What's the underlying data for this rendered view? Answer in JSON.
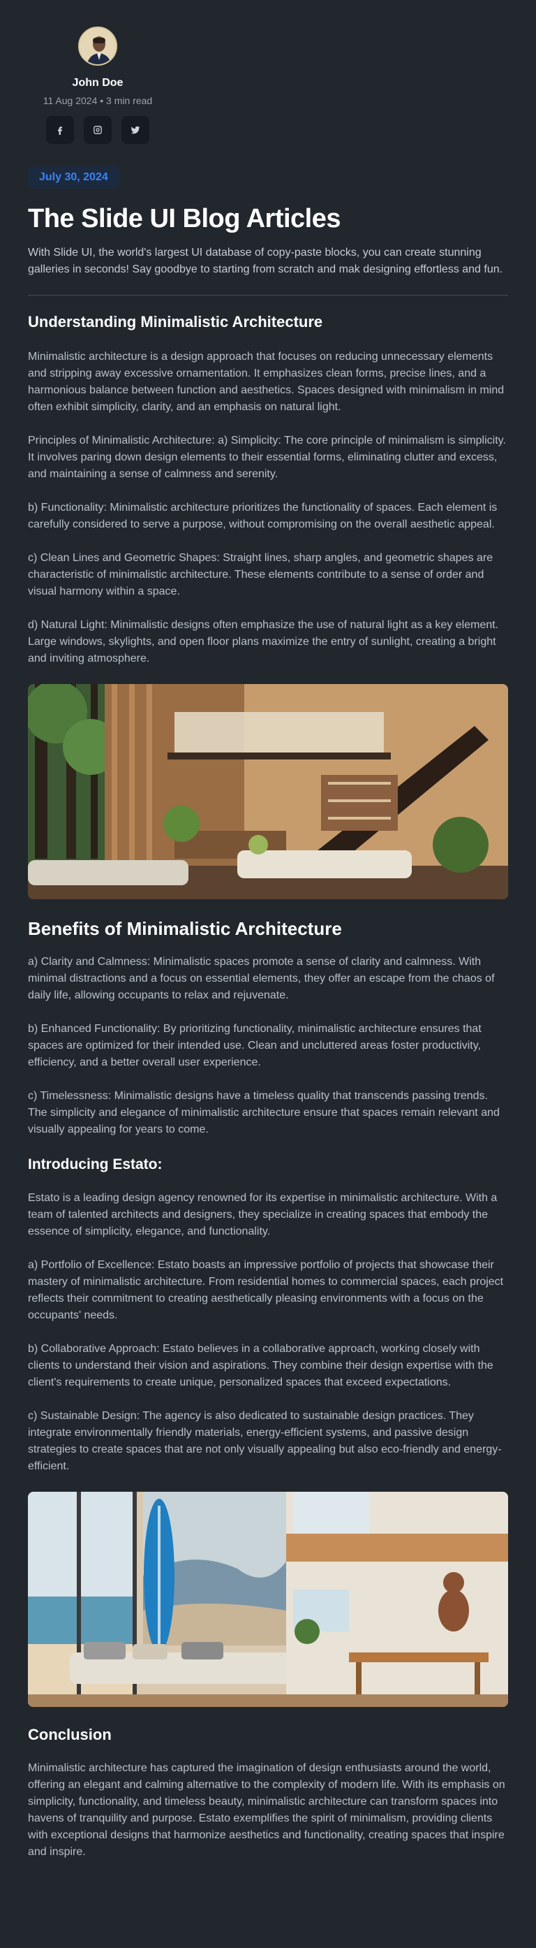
{
  "author": {
    "name": "John Doe",
    "meta": "11 Aug 2024 • 3 min read",
    "socials": [
      {
        "icon": "facebook-icon"
      },
      {
        "icon": "instagram-icon"
      },
      {
        "icon": "twitter-icon"
      }
    ]
  },
  "article": {
    "date": "July 30, 2024",
    "title": "The Slide UI Blog Articles",
    "intro": "With Slide UI, the world's largest UI database of copy-paste blocks, you can create stunning galleries in seconds! Say goodbye to starting from scratch and mak designing effortless and fun.",
    "section1": {
      "heading": "Understanding Minimalistic Architecture",
      "paragraphs": [
        "Minimalistic architecture is a design approach that focuses on reducing unnecessary elements and stripping away excessive ornamentation. It emphasizes clean forms, precise lines, and a harmonious balance between function and aesthetics. Spaces designed with minimalism in mind often exhibit simplicity, clarity, and an emphasis on natural light.",
        "Principles of Minimalistic Architecture: a) Simplicity: The core principle of minimalism is simplicity. It involves paring down design elements to their essential forms, eliminating clutter and excess, and maintaining a sense of calmness and serenity.",
        "b) Functionality: Minimalistic architecture prioritizes the functionality of spaces. Each element is carefully considered to serve a purpose, without compromising on the overall aesthetic appeal.",
        "c) Clean Lines and Geometric Shapes: Straight lines, sharp angles, and geometric shapes are characteristic of minimalistic architecture. These elements contribute to a sense of order and visual harmony within a space.",
        "d) Natural Light: Minimalistic designs often emphasize the use of natural light as a key element. Large windows, skylights, and open floor plans maximize the entry of sunlight, creating a bright and inviting atmosphere."
      ]
    },
    "section2": {
      "heading": "Benefits of Minimalistic Architecture",
      "paragraphs": [
        "a) Clarity and Calmness: Minimalistic spaces promote a sense of clarity and calmness. With minimal distractions and a focus on essential elements, they offer an escape from the chaos of daily life, allowing occupants to relax and rejuvenate.",
        "b) Enhanced Functionality: By prioritizing functionality, minimalistic architecture ensures that spaces are optimized for their intended use. Clean and uncluttered areas foster productivity, efficiency, and a better overall user experience.",
        "c) Timelessness: Minimalistic designs have a timeless quality that transcends passing trends. The simplicity and elegance of minimalistic architecture ensure that spaces remain relevant and visually appealing for years to come."
      ]
    },
    "section3": {
      "heading": "Introducing Estato:",
      "paragraphs": [
        "Estato is a leading design agency renowned for its expertise in minimalistic architecture. With a team of talented architects and designers, they specialize in creating spaces that embody the essence of simplicity, elegance, and functionality.",
        "a) Portfolio of Excellence: Estato boasts an impressive portfolio of projects that showcase their mastery of minimalistic architecture. From residential homes to commercial spaces, each project reflects their commitment to creating aesthetically pleasing environments with a focus on the occupants' needs.",
        "b) Collaborative Approach: Estato believes in a collaborative approach, working closely with clients to understand their vision and aspirations. They combine their design expertise with the client's requirements to create unique, personalized spaces that exceed expectations.",
        "c) Sustainable Design: The agency is also dedicated to sustainable design practices. They integrate environmentally friendly materials, energy-efficient systems, and passive design strategies to create spaces that are not only visually appealing but also eco-friendly and energy-efficient."
      ]
    },
    "section4": {
      "heading": "Conclusion",
      "paragraphs": [
        "Minimalistic architecture has captured the imagination of design enthusiasts around the world, offering an elegant and calming alternative to the complexity of modern life. With its emphasis on simplicity, functionality, and timeless beauty, minimalistic architecture can transform spaces into havens of tranquility and purpose. Estato exemplifies the spirit of minimalism, providing clients with exceptional designs that harmonize aesthetics and functionality, creating spaces that inspire and inspire."
      ]
    }
  },
  "colors": {
    "background": "#22272e",
    "badge_bg": "#1c2a3f",
    "badge_text": "#3b82f6",
    "divider": "#444c56"
  }
}
